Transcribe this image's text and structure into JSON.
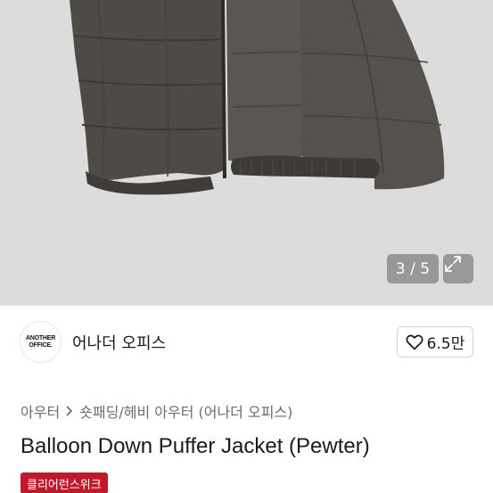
{
  "gallery": {
    "counter": "3 / 5",
    "current": 3,
    "total": 5
  },
  "shop": {
    "logo_text": "ANOTHER OFFICE.",
    "logo_line1": "ANOTHER",
    "logo_line2": "OFFICE.",
    "name": "어나더 오피스"
  },
  "like": {
    "count": "6.5만"
  },
  "breadcrumb": {
    "level1": "아우터",
    "level2": "숏패딩/헤비 아우터 (어나더 오피스)"
  },
  "product": {
    "title": "Balloon Down Puffer Jacket (Pewter)",
    "badge": "클리어런스위크"
  },
  "colors": {
    "badge": "#c0192c",
    "jacket": "#4f4c48",
    "background": "#dcdcdc"
  }
}
